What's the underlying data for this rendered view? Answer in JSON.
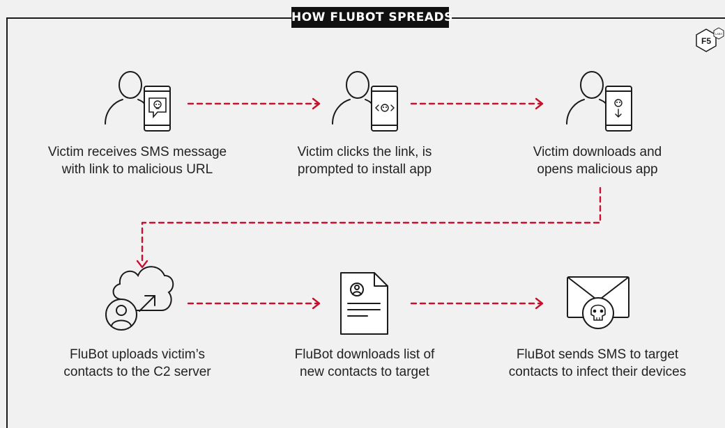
{
  "title": "HOW FLUBOT SPREADS",
  "logo": {
    "brand": "F5",
    "sub": "LABS"
  },
  "colors": {
    "accent": "#c8102e",
    "ink": "#1a1a1a",
    "panel": "#f1f1f1"
  },
  "steps": [
    {
      "line1": "Victim receives SMS message",
      "line2": "with link to malicious URL",
      "icon": "victim-phone-sms-skull-icon"
    },
    {
      "line1": "Victim clicks the link, is",
      "line2": "prompted to install app",
      "icon": "victim-phone-code-skull-icon"
    },
    {
      "line1": "Victim downloads and",
      "line2": "opens malicious app",
      "icon": "victim-phone-download-skull-icon"
    },
    {
      "line1": "FluBot uploads victim’s",
      "line2": "contacts to the C2 server",
      "icon": "cloud-upload-user-icon"
    },
    {
      "line1": "FluBot downloads list of",
      "line2": "new contacts to target",
      "icon": "contact-document-icon"
    },
    {
      "line1": "FluBot sends SMS to target",
      "line2": "contacts to infect their devices",
      "icon": "skull-envelope-icon"
    }
  ]
}
